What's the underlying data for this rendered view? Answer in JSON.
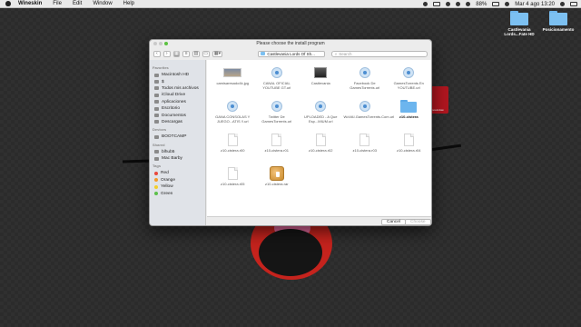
{
  "menubar": {
    "app_name": "Wineskin",
    "items": [
      "File",
      "Edit",
      "Window",
      "Help"
    ],
    "battery": "88%",
    "datetime": "Mar 4 ago 13:20"
  },
  "desktop": {
    "folders": [
      {
        "label": "Castlevania Lords...Fate HD"
      },
      {
        "label": "Posicionamento"
      }
    ],
    "mini_window_label": "ninewindow"
  },
  "dialog": {
    "title": "Please choose the install program",
    "path": "Castlevania Lords Of Sh...",
    "search_placeholder": "Search",
    "sidebar": {
      "favorites_header": "Favorites",
      "favorites": [
        "Macintosh HD",
        "$",
        "Todos mis archivos",
        "iCloud Drive",
        "Aplicaciones",
        "Escritorio",
        "Documentos",
        "Descargas"
      ],
      "devices_header": "Devices",
      "devices": [
        "BOOTCAMP"
      ],
      "shared_header": "Shared",
      "shared": [
        "blhub5",
        "Mac Barby"
      ],
      "tags_header": "Tags",
      "tags": [
        {
          "label": "Red",
          "color": "#e8473c"
        },
        {
          "label": "Orange",
          "color": "#f39a2b"
        },
        {
          "label": "Yellow",
          "color": "#f3cf2b"
        },
        {
          "label": "Green",
          "color": "#5cc04a"
        }
      ]
    },
    "files": [
      {
        "label": "camisaresado4k.jpg",
        "icon": "image-thumb",
        "bold": false
      },
      {
        "label": "CANAL OFICIAL YOUTUBE GT.url",
        "icon": "link-icon",
        "bold": false
      },
      {
        "label": "Castlevania",
        "icon": "app-thumb",
        "bold": false
      },
      {
        "label": "Facebook De GamesTorrents.url",
        "icon": "link-icon",
        "bold": false
      },
      {
        "label": "GamesTorrents En YOUTUBE.url",
        "icon": "link-icon",
        "bold": false
      },
      {
        "label": "GANA CONSOLAS Y JUEGO...ATIS !!.url",
        "icon": "link-icon",
        "bold": false
      },
      {
        "label": "Twitter De GamesTorrents.url",
        "icon": "link-icon",
        "bold": false
      },
      {
        "label": "UPLOADED - A Que Esp...MIUM.url",
        "icon": "link-icon",
        "bold": false
      },
      {
        "label": "WoVAI.GamesTorrents.Com.url",
        "icon": "link-icon",
        "bold": false
      },
      {
        "label": "z10-cistera",
        "icon": "folder-icon",
        "bold": true
      },
      {
        "label": "z10-cistera.r00",
        "icon": "document-icon",
        "bold": false
      },
      {
        "label": "z10-cistera.r01",
        "icon": "document-icon",
        "bold": false
      },
      {
        "label": "z10-cistera.r02",
        "icon": "document-icon",
        "bold": false
      },
      {
        "label": "z10-cistera.r03",
        "icon": "document-icon",
        "bold": false
      },
      {
        "label": "z10-cistera.r04",
        "icon": "document-icon",
        "bold": false
      },
      {
        "label": "z10-cistera.r05",
        "icon": "document-icon",
        "bold": false
      },
      {
        "label": "z10-cistera.rar",
        "icon": "archive-icon",
        "bold": false
      }
    ],
    "buttons": {
      "cancel": "Cancel",
      "choose": "Choose"
    }
  }
}
